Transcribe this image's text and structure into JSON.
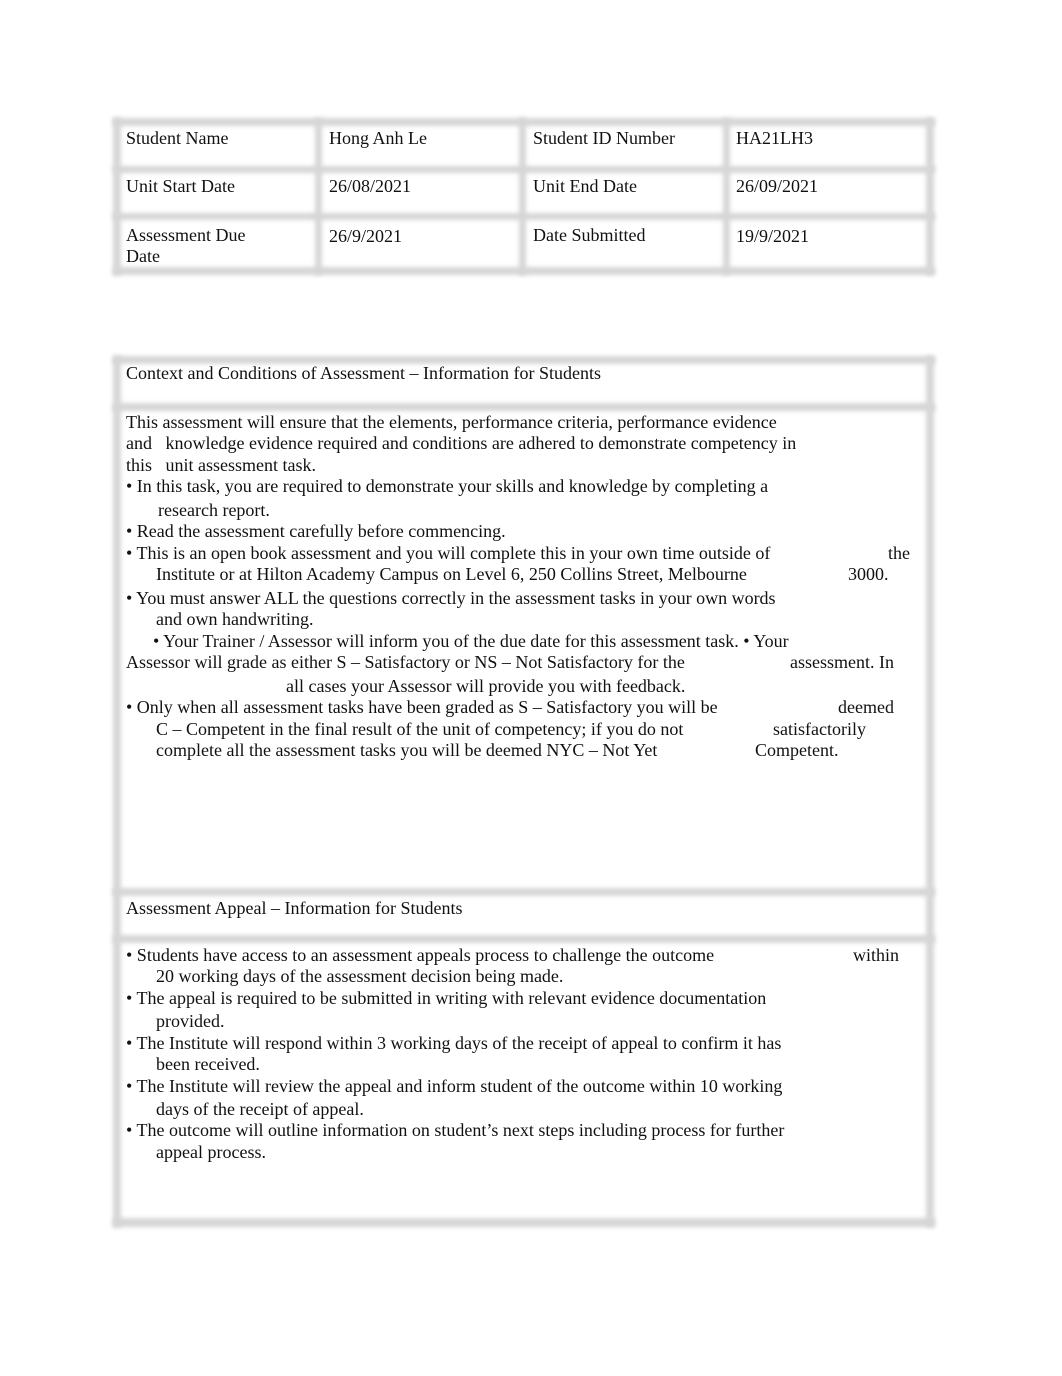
{
  "student_table": {
    "rows": [
      {
        "label1": "Student Name",
        "value1": "Hong Anh Le",
        "label2": "Student ID Number",
        "value2": "HA21LH3"
      },
      {
        "label1": "Unit Start Date",
        "value1": "26/08/2021",
        "label2": "Unit End Date",
        "value2": "26/09/2021"
      },
      {
        "label1": "Assessment Due",
        "label1b": "Date",
        "value1": "26/9/2021",
        "label2": "Date Submitted",
        "value2": "19/9/2021"
      }
    ]
  },
  "context": {
    "heading": "Context and Conditions of Assessment – Information for Students",
    "lines": [
      [
        "This assessment will ensure that the elements, performance criteria, performance evidence"
      ],
      [
        "and   knowledge evidence required and conditions are adhered to demonstrate competency in"
      ],
      [
        "this   unit assessment task."
      ],
      [
        "• In this task, you are required to demonstrate your skills and knowledge by completing a"
      ],
      [
        "research report."
      ],
      [
        "• Read the assessment carefully before commencing."
      ],
      [
        "• This is an open book assessment and you will complete this in your own time outside of",
        "the"
      ],
      [
        "Institute or at Hilton Academy Campus on Level 6, 250 Collins Street, Melbourne",
        "3000."
      ],
      [
        "• You must answer ALL the questions correctly in the assessment tasks in your own words"
      ],
      [
        "and own handwriting."
      ],
      [
        "• Your Trainer / Assessor will inform you of the due date for this assessment task. • Your"
      ],
      [
        "Assessor will grade as either S – Satisfactory or NS – Not Satisfactory for the",
        "assessment. In"
      ],
      [
        "all cases your Assessor will provide you with feedback."
      ],
      [
        "• Only when all assessment tasks have been graded as S – Satisfactory you will be",
        "deemed"
      ],
      [
        "C – Competent in the final result of the unit of competency; if you do not",
        "satisfactorily"
      ],
      [
        "complete all the assessment tasks you will be deemed NYC – Not Yet",
        "Competent."
      ]
    ]
  },
  "appeal": {
    "heading": "Assessment Appeal – Information for Students",
    "lines": [
      [
        "• Students have access to an assessment appeals process to challenge the outcome",
        "within"
      ],
      [
        "20 working days of the assessment decision being made."
      ],
      [
        "• The appeal is required to be submitted in writing with relevant evidence documentation"
      ],
      [
        "provided."
      ],
      [
        "• The Institute will respond within 3 working days of the receipt of appeal to confirm it has"
      ],
      [
        "been received."
      ],
      [
        "• The Institute will review the appeal and inform student of the outcome within 10 working"
      ],
      [
        "days of the receipt of appeal."
      ],
      [
        "• The outcome will outline information on student’s next steps including process for further"
      ],
      [
        "appeal process."
      ]
    ]
  }
}
